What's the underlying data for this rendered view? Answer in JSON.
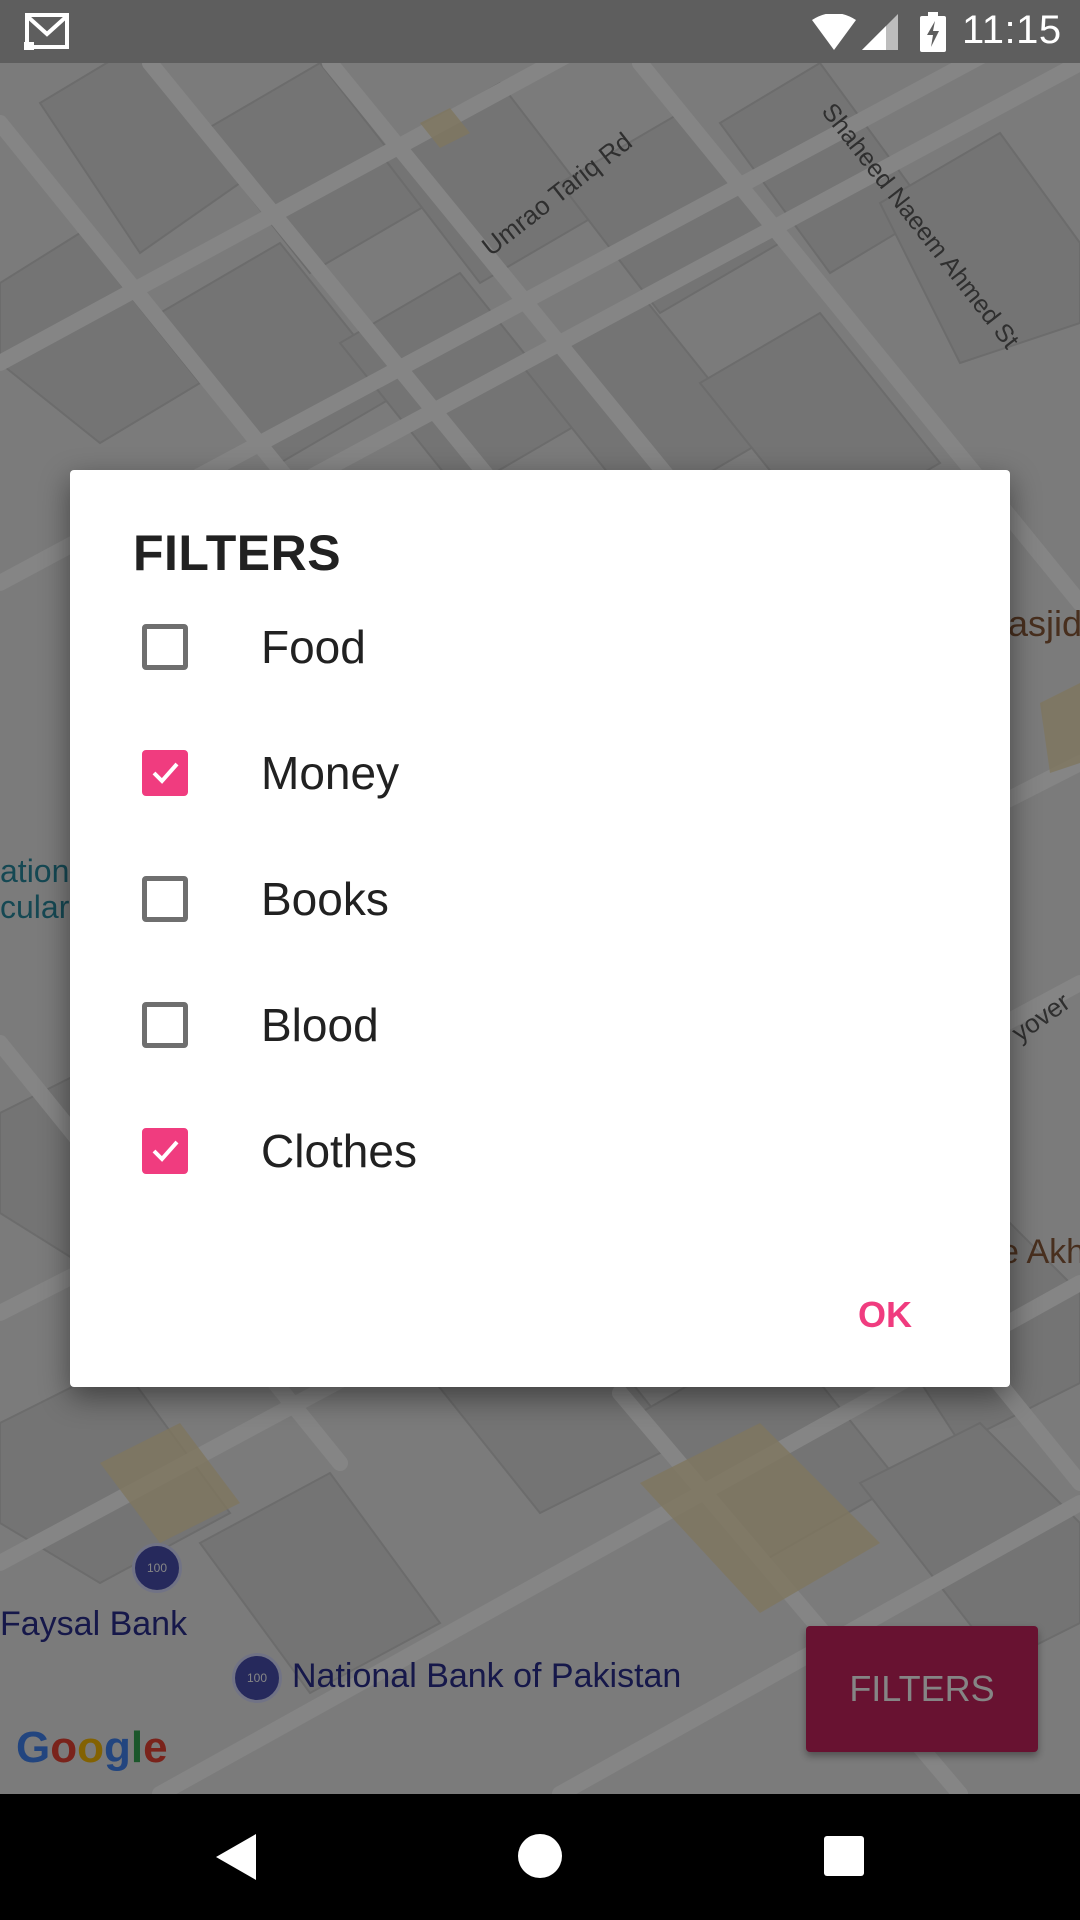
{
  "status_bar": {
    "time": "11:15",
    "icons": [
      "mail-icon",
      "wifi-icon",
      "signal-icon",
      "battery-charging-icon"
    ]
  },
  "map": {
    "labels": {
      "umrao": "Umrao Tariq Rd",
      "shaheed": "Shaheed Naeem Ahmed St",
      "masjid_partial": "asjid",
      "ation_partial": "ation",
      "cular_partial": "cular",
      "flyover_partial": "yover",
      "akh_partial": "e Akh"
    },
    "pois": {
      "faysal": "Faysal Bank",
      "nbp": "National Bank of Pakistan",
      "poi_icon_text": "100"
    },
    "google_logo": "Google"
  },
  "fab": {
    "label": "FILTERS"
  },
  "dialog": {
    "title": "FILTERS",
    "items": [
      {
        "label": "Food",
        "checked": false
      },
      {
        "label": "Money",
        "checked": true
      },
      {
        "label": "Books",
        "checked": false
      },
      {
        "label": "Blood",
        "checked": false
      },
      {
        "label": "Clothes",
        "checked": true
      }
    ],
    "ok_label": "OK"
  },
  "colors": {
    "accent": "#f03c7f",
    "fab": "#c8235e",
    "status_bar": "#5e5e5e",
    "nav_bar": "#000000"
  },
  "nav_bar": {
    "icons": [
      "back-icon",
      "home-icon",
      "recents-icon"
    ]
  }
}
